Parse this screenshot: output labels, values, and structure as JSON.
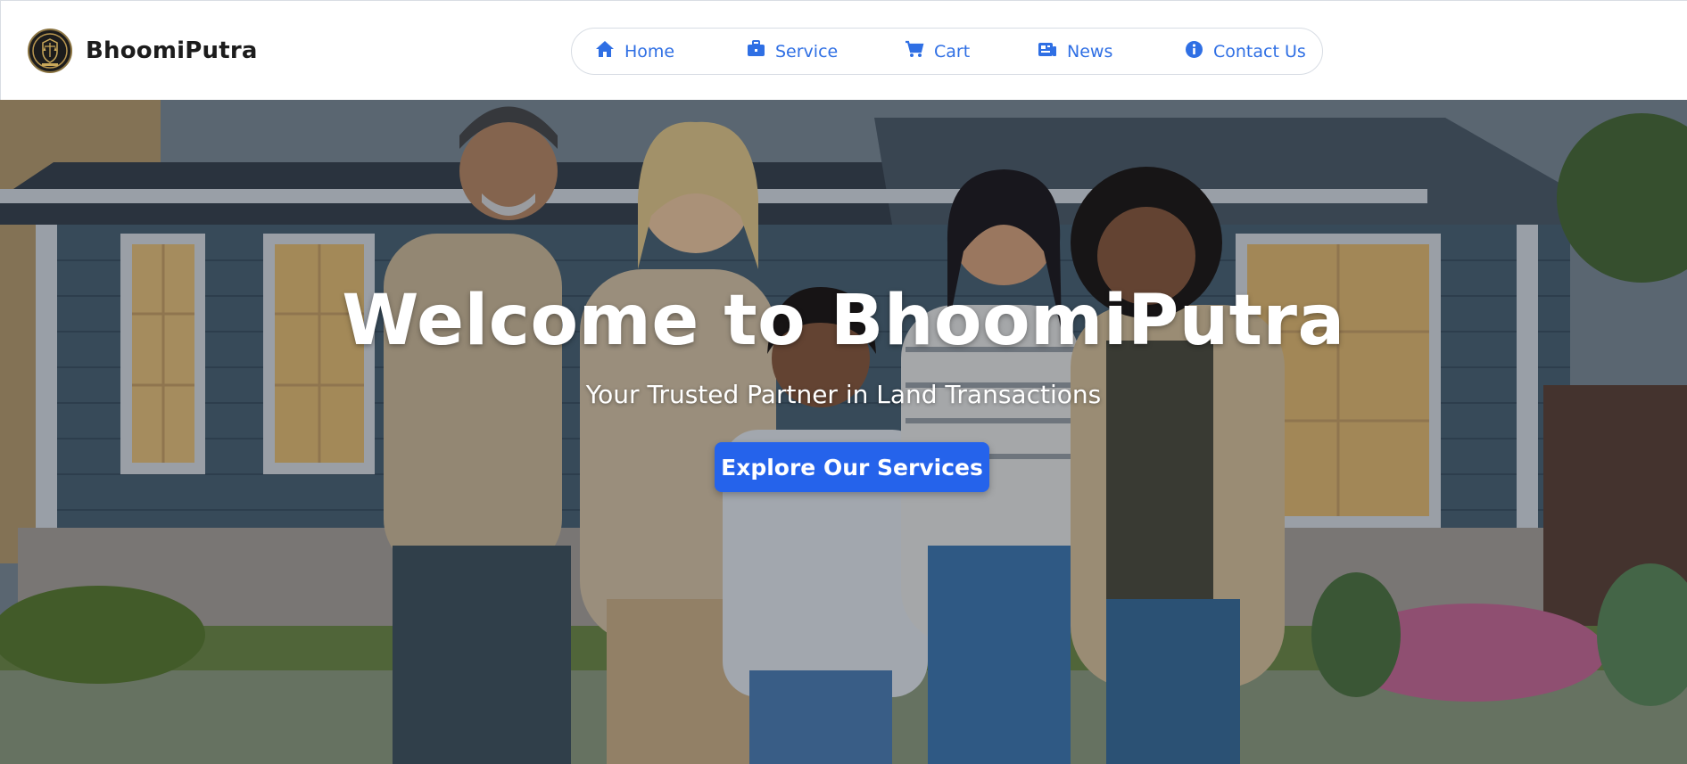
{
  "brand": {
    "name": "BhoomiPutra",
    "logo_icon": "scales-of-justice-logo-icon"
  },
  "nav": {
    "items": [
      {
        "label": "Home",
        "icon": "home-icon"
      },
      {
        "label": "Service",
        "icon": "briefcase-icon"
      },
      {
        "label": "Cart",
        "icon": "cart-icon"
      },
      {
        "label": "News",
        "icon": "newspaper-icon"
      },
      {
        "label": "Contact Us",
        "icon": "info-icon"
      }
    ]
  },
  "hero": {
    "title": "Welcome to BhoomiPutra",
    "subtitle": "Your Trusted Partner in Land Transactions",
    "cta_label": "Explore Our Services",
    "image": "family-in-front-of-house-illustration"
  },
  "colors": {
    "accent": "#2563eb",
    "nav_text": "#2f6fe4",
    "brand_text": "#1c1c1c"
  }
}
